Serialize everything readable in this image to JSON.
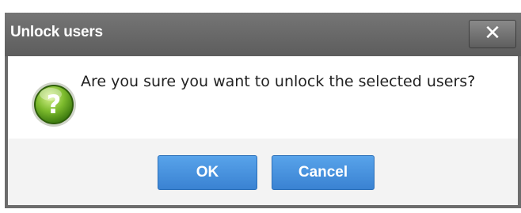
{
  "dialog": {
    "title": "Unlock users",
    "close_label": "✕",
    "message": "Are you sure you want to unlock the selected users?",
    "icon": "question-icon",
    "buttons": {
      "ok_label": "OK",
      "cancel_label": "Cancel"
    }
  },
  "colors": {
    "titlebar": "#6c6c6c",
    "button_blue": "#3f8ad8",
    "icon_green": "#6fae2a"
  }
}
